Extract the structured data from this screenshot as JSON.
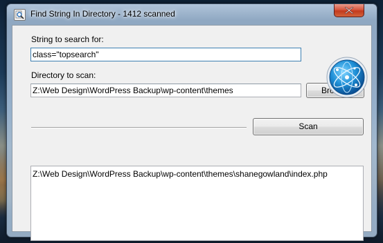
{
  "window": {
    "title": "Find String In Directory - 1412 scanned",
    "app_icon": "magnifier-document-icon",
    "close_icon": "close-icon"
  },
  "search": {
    "label": "String to search for:",
    "value": "class=\"topsearch\""
  },
  "directory": {
    "label": "Directory to scan:",
    "value": "Z:\\Web Design\\WordPress Backup\\wp-content\\themes",
    "browse_label": "Browse"
  },
  "scan": {
    "button_label": "Scan"
  },
  "results": [
    "Z:\\Web Design\\WordPress Backup\\wp-content\\themes\\shanegowland\\index.php"
  ],
  "logo": {
    "icon": "atom-globe-logo",
    "accent": "#2f9fe0"
  },
  "colors": {
    "close_button": "#c23a1e",
    "focus_border": "#3c7fb1"
  }
}
